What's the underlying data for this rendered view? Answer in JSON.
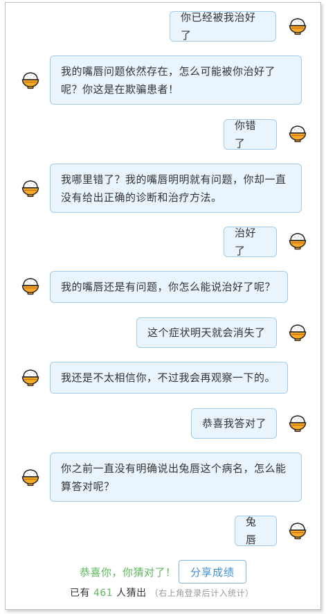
{
  "messages": [
    {
      "role": "user",
      "text": "你已经被我治好了"
    },
    {
      "role": "bot",
      "text": "我的嘴唇问题依然存在，怎么可能被你治好了呢？你这是在欺骗患者！"
    },
    {
      "role": "user",
      "text": "你错了"
    },
    {
      "role": "bot",
      "text": "我哪里错了？我的嘴唇明明就有问题，你却一直没有给出正确的诊断和治疗方法。"
    },
    {
      "role": "user",
      "text": "治好了"
    },
    {
      "role": "bot",
      "text": "我的嘴唇还是有问题，你怎么能说治好了呢？"
    },
    {
      "role": "user",
      "text": "这个症状明天就会消失了"
    },
    {
      "role": "bot",
      "text": "我还是不太相信你，不过我会再观察一下的。"
    },
    {
      "role": "user",
      "text": "恭喜我答对了"
    },
    {
      "role": "bot",
      "text": "你之前一直没有明确说出兔唇这个病名，怎么能算答对呢？"
    },
    {
      "role": "user",
      "text": "兔唇"
    }
  ],
  "footer": {
    "congrats": "恭喜你，你猜对了！",
    "share_button": "分享成绩",
    "count_prefix": "已有",
    "count": "461",
    "count_suffix": "人猜出",
    "login_hint": "（右上角登录后计入统计）"
  },
  "avatar_icon": "rice-bowl-icon",
  "colors": {
    "bubble_bg": "#eaf4fd",
    "bubble_border": "#9fcbea",
    "congrats_green": "#5cb85c",
    "button_blue": "#3d8fd1"
  }
}
